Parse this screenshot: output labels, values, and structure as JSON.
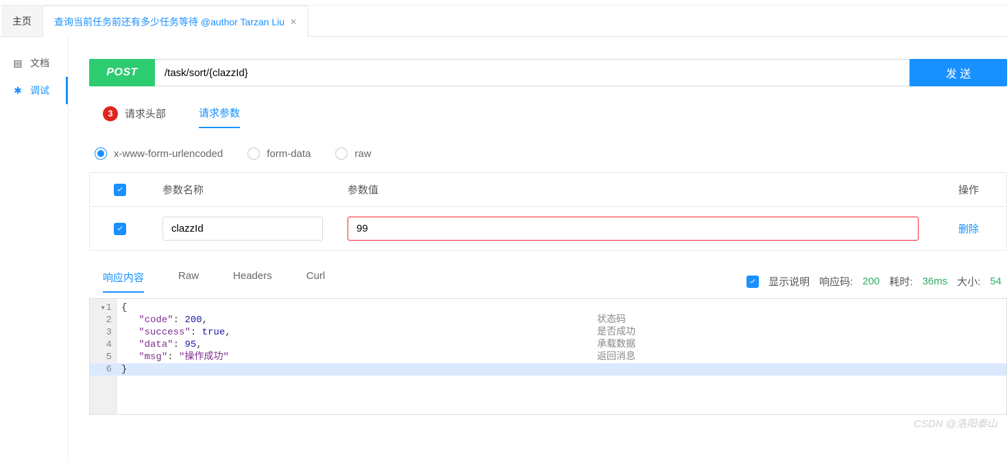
{
  "tabs": {
    "home": "主页",
    "active": "查询当前任务前还有多少任务等待 @author Tarzan Liu"
  },
  "sidebar": {
    "docs": "文档",
    "debug": "调试"
  },
  "request": {
    "method": "POST",
    "url": "/task/sort/{clazzId}",
    "send": "发 送",
    "header_tab": "请求头部",
    "header_badge": "3",
    "param_tab": "请求参数",
    "body_types": {
      "form": "x-www-form-urlencoded",
      "formdata": "form-data",
      "raw": "raw"
    },
    "table": {
      "th_name": "参数名称",
      "th_value": "参数值",
      "th_op": "操作",
      "rows": [
        {
          "name": "clazzId",
          "value": "99",
          "op": "删除"
        }
      ]
    }
  },
  "response": {
    "tabs": {
      "content": "响应内容",
      "raw": "Raw",
      "headers": "Headers",
      "curl": "Curl"
    },
    "show_desc": "显示说明",
    "code_label": "响应码:",
    "code_val": "200",
    "time_label": "耗时:",
    "time_val": "36ms",
    "size_label": "大小:",
    "size_val": "54",
    "json": {
      "code": 200,
      "success": true,
      "data": 95,
      "msg": "操作成功"
    },
    "desc": {
      "code": "状态码",
      "success": "是否成功",
      "data": "承载数据",
      "msg": "返回消息"
    }
  },
  "watermark": "CSDN @洛阳泰山"
}
